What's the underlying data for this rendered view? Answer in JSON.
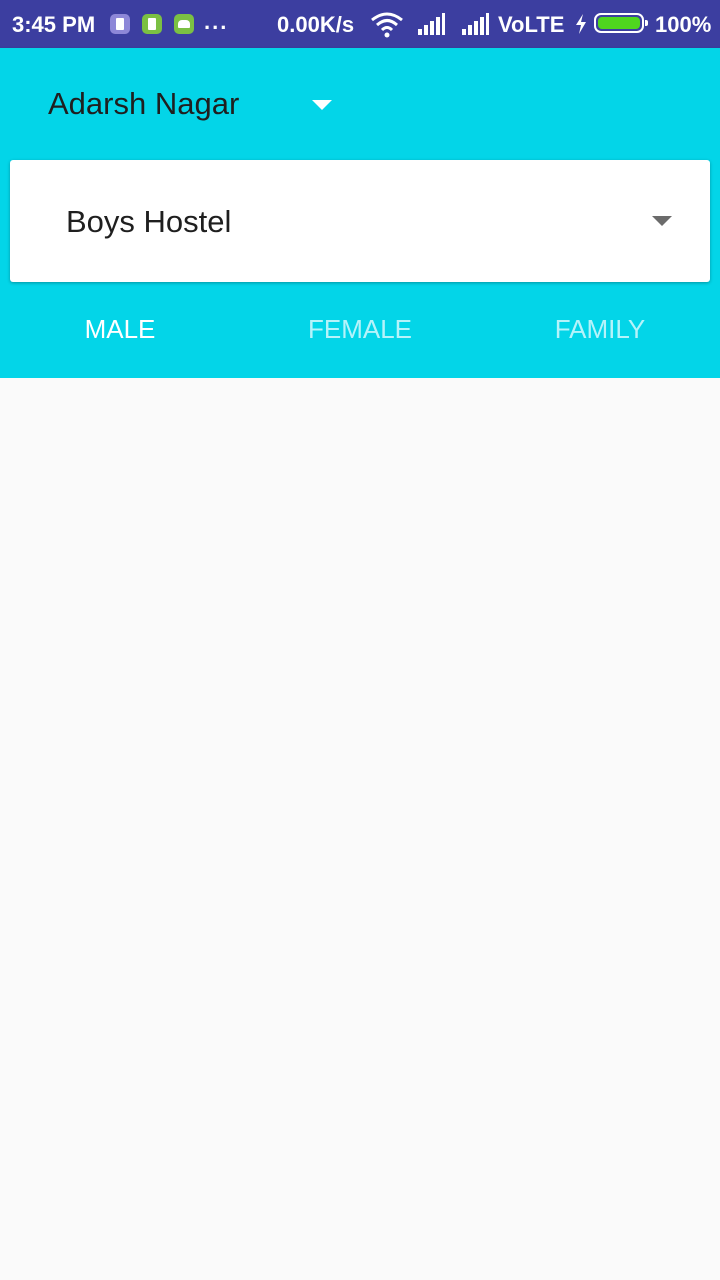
{
  "status_bar": {
    "time": "3:45 PM",
    "dots": "...",
    "speed": "0.00K/s",
    "network": "VoLTE",
    "battery": "100%",
    "icons": [
      "notification-app-icon",
      "notification-sim-icon",
      "notification-android-icon",
      "wifi-icon",
      "signal-icon",
      "signal-icon",
      "charging-icon",
      "battery-icon"
    ],
    "colors": {
      "background": "#3c3ea0",
      "battery_fill": "#4fd61f"
    }
  },
  "app_bar": {
    "location": "Adarsh Nagar",
    "accommodation_type": "Boys Hostel",
    "tabs": [
      {
        "label": "MALE",
        "selected": true
      },
      {
        "label": "FEMALE",
        "selected": false
      },
      {
        "label": "FAMILY",
        "selected": false
      }
    ],
    "colors": {
      "background": "#03d5e8",
      "tab_selected": "#ffffff",
      "tab_unselected": "#b5f3fa"
    }
  }
}
